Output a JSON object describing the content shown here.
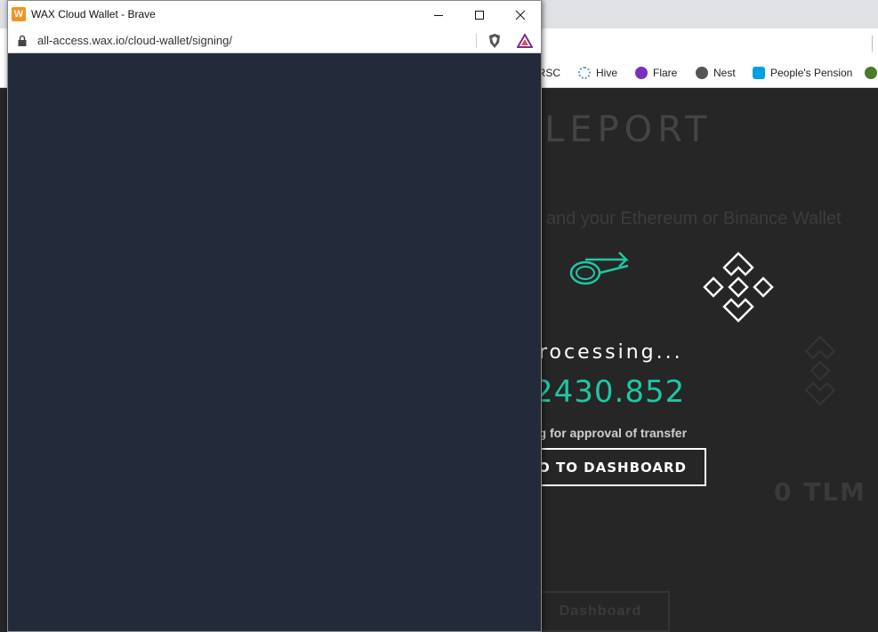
{
  "popup": {
    "title": "WAX Cloud Wallet - Brave",
    "app_icon_letter": "W",
    "url": "all-access.wax.io/cloud-wallet/signing/",
    "content_color": "#232a39",
    "icons": [
      "lock-icon",
      "brave-shield-icon",
      "brave-rewards-icon",
      "minimize-icon",
      "maximize-icon",
      "close-icon"
    ]
  },
  "bookmarks": [
    {
      "label": "CRSC",
      "color": "#c0392b"
    },
    {
      "label": "Hive",
      "color": "#5b9bd5"
    },
    {
      "label": "Flare",
      "color": "#7b2fbf"
    },
    {
      "label": "Nest",
      "color": "#555555"
    },
    {
      "label": "People's Pension",
      "color": "#00a0e0"
    }
  ],
  "page": {
    "heading_fragment": "LEPORT",
    "subtitle_fragment": "and your Ethereum or Binance Wallet",
    "processing_fragment": "rocessing...",
    "amount_fragment": "2430.852",
    "waiting_fragment": "ng for approval of transfer",
    "back_button_fragment": "O TO DASHBOARD",
    "balance_text": "0 TLM",
    "dashboard_button": "Dashboard",
    "accent_color": "#1fc7a4"
  }
}
